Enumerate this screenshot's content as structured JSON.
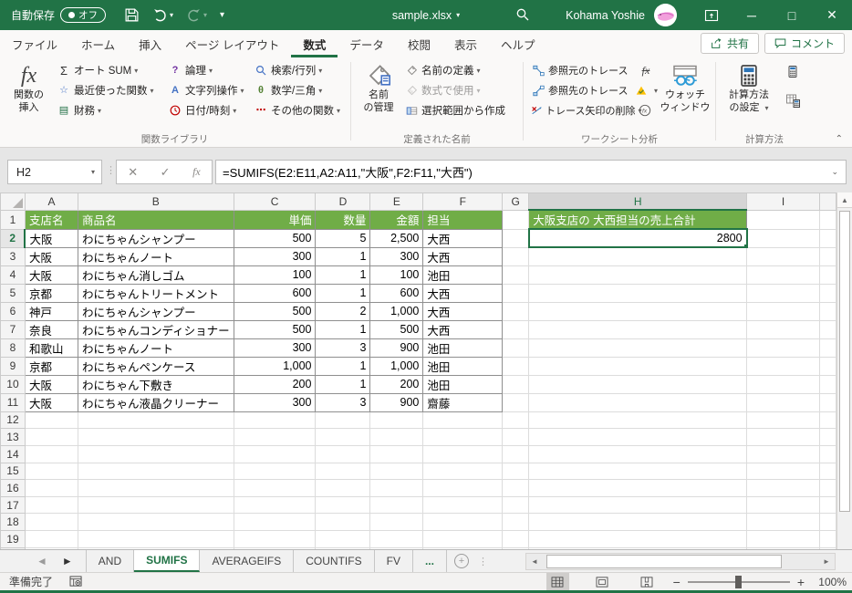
{
  "titlebar": {
    "autosave_label": "自動保存",
    "autosave_state": "オフ",
    "filename": "sample.xlsx",
    "user_name": "Kohama Yoshie"
  },
  "tabs": {
    "items": [
      {
        "label": "ファイル",
        "active": false
      },
      {
        "label": "ホーム",
        "active": false
      },
      {
        "label": "挿入",
        "active": false
      },
      {
        "label": "ページ レイアウト",
        "active": false
      },
      {
        "label": "数式",
        "active": true
      },
      {
        "label": "データ",
        "active": false
      },
      {
        "label": "校閲",
        "active": false
      },
      {
        "label": "表示",
        "active": false
      },
      {
        "label": "ヘルプ",
        "active": false
      }
    ],
    "share": "共有",
    "comments": "コメント"
  },
  "ribbon": {
    "insert_function_l1": "関数の",
    "insert_function_l2": "挿入",
    "library": {
      "label": "関数ライブラリ",
      "autosum": "オート SUM",
      "recent": "最近使った関数",
      "financial": "財務",
      "logical": "論理",
      "text": "文字列操作",
      "datetime": "日付/時刻",
      "lookup": "検索/行列",
      "math": "数学/三角",
      "more": "その他の関数"
    },
    "names": {
      "label": "定義された名前",
      "manager_l1": "名前",
      "manager_l2": "の管理",
      "define": "名前の定義",
      "use": "数式で使用",
      "create": "選択範囲から作成"
    },
    "audit": {
      "label": "ワークシート分析",
      "precedents": "参照元のトレース",
      "dependents": "参照先のトレース",
      "remove": "トレース矢印の削除",
      "watch_l1": "ウォッチ",
      "watch_l2": "ウィンドウ"
    },
    "calc": {
      "label": "計算方法",
      "options_l1": "計算方法",
      "options_l2": "の設定"
    }
  },
  "formula_bar": {
    "cell_ref": "H2",
    "formula": "=SUMIFS(E2:E11,A2:A11,\"大阪\",F2:F11,\"大西\")"
  },
  "grid": {
    "col_letters": [
      "A",
      "B",
      "C",
      "D",
      "E",
      "F",
      "G",
      "H",
      "I"
    ],
    "selected_col": "H",
    "selected_row": 2,
    "row_count": 20,
    "header_cells": [
      "支店名",
      "商品名",
      "単価",
      "数量",
      "金額",
      "担当"
    ],
    "h1_title": "大阪支店の 大西担当の売上合計",
    "h2_value": "2800",
    "data_rows": [
      [
        "大阪",
        "わにちゃんシャンプー",
        "500",
        "5",
        "2,500",
        "大西"
      ],
      [
        "大阪",
        "わにちゃんノート",
        "300",
        "1",
        "300",
        "大西"
      ],
      [
        "大阪",
        "わにちゃん消しゴム",
        "100",
        "1",
        "100",
        "池田"
      ],
      [
        "京都",
        "わにちゃんトリートメント",
        "600",
        "1",
        "600",
        "大西"
      ],
      [
        "神戸",
        "わにちゃんシャンプー",
        "500",
        "2",
        "1,000",
        "大西"
      ],
      [
        "奈良",
        "わにちゃんコンディショナー",
        "500",
        "1",
        "500",
        "大西"
      ],
      [
        "和歌山",
        "わにちゃんノート",
        "300",
        "3",
        "900",
        "池田"
      ],
      [
        "京都",
        "わにちゃんペンケース",
        "1,000",
        "1",
        "1,000",
        "池田"
      ],
      [
        "大阪",
        "わにちゃん下敷き",
        "200",
        "1",
        "200",
        "池田"
      ],
      [
        "大阪",
        "わにちゃん液晶クリーナー",
        "300",
        "3",
        "900",
        "齋藤"
      ]
    ]
  },
  "sheet_tabs": {
    "items": [
      {
        "label": "AND",
        "active": false
      },
      {
        "label": "SUMIFS",
        "active": true
      },
      {
        "label": "AVERAGEIFS",
        "active": false
      },
      {
        "label": "COUNTIFS",
        "active": false
      },
      {
        "label": "FV",
        "active": false
      },
      {
        "label": "...",
        "active": false
      }
    ]
  },
  "status_bar": {
    "ready": "準備完了",
    "zoom_level": "100%"
  },
  "colors": {
    "accent_green": "#217346",
    "header_green": "#70AD47"
  }
}
